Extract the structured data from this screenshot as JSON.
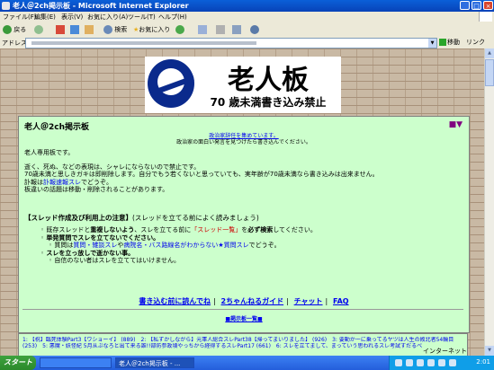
{
  "window": {
    "title": "老人＠2ch掲示板 - Microsoft Internet Explorer"
  },
  "menu": [
    "ファイル(F)",
    "編集(E)",
    "表示(V)",
    "お気に入り(A)",
    "ツール(T)",
    "ヘルプ(H)"
  ],
  "toolbar": {
    "back": "戻る",
    "search": "検索",
    "favorites": "お気に入り"
  },
  "address": {
    "label": "アドレス(D)",
    "go": "移動",
    "links": "リンク"
  },
  "banner": {
    "big": "老人板",
    "small": "70 歳未満書き込み禁止"
  },
  "board": {
    "title": "老人＠2ch掲示板",
    "nav": "■▼",
    "notice_link": "政治家辞任を集めています。",
    "notice_text": "政治家の面白い発言を見つけたら書き込んでください。",
    "intro": "老人専用板です。",
    "line1": "逝く、死ぬ、などの表現は、シャレにならないので禁止です。",
    "line2": "70歳未満と思しきガキは即削除します。自分でもう若くないと思っていても、実年齢が70歳未満なら書き込みは出来ません。",
    "line3a": "訃報は",
    "line3_link": "訃報速報スレ",
    "line3b": "でどうぞ。",
    "line4": "板違いの話題は移動・削除されることがあります。",
    "rules_head": "【スレッド作成及び利用上の注意】",
    "rules_note": "(スレッドを立てる前によく読みましょう)",
    "rule1a": "既存スレッドと",
    "rule1b": "重複しないよう",
    "rule1c": "、スレを立てる前に",
    "rule1_link": "「スレッド一覧」",
    "rule1d": "を",
    "rule1e": "必ず検索",
    "rule1f": "してください。",
    "rule2": "単発質問でスレを立てないでください。",
    "rule2_sub_a": "質問は",
    "rule2_link1": "質問・雑談スレ",
    "rule2_sub_b": "や",
    "rule2_link2": "病院名・バス路線名がわからない★質問スレ",
    "rule2_sub_c": "でどうぞ。",
    "rule3": "スレを立っ放しで逝かない事。",
    "rule3_sub": "自信のない者はスレを立ててはいけません。",
    "links": [
      "書き込む前に読んでね",
      "2ちゃんねるガイド",
      "チャット",
      "FAQ"
    ],
    "list_link": "■掲示板一覧■"
  },
  "threads": {
    "row1": "1: 【祝】臨死体験Part3【ワショーイ】 (889)　2: 【私ずかしながら】元軍人総合スレPart38【帰ってまいりました】 (926)　3: 要動かーに乗ってるヤツは人生の敗北者54輪目",
    "row2": "(253)　5: 悪魔・妖怪紀 5月从ぶなろと出て来る誰!!部防参政頃やっちから経得するスレPart17 (661)　6: スレを立てまして、まっていう思われるスレ考試すだるべ"
  },
  "taskbar": {
    "start": "スタート",
    "tasks": [
      "",
      "老人＠2ch掲示板 - ..."
    ],
    "status": "インターネット",
    "clock": "2:01"
  }
}
